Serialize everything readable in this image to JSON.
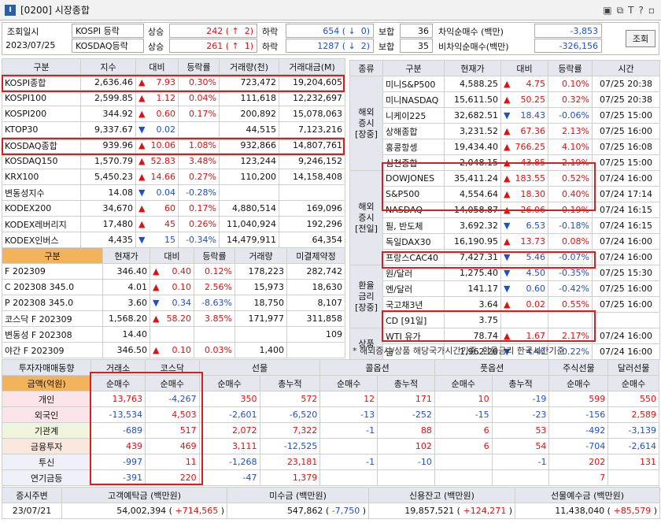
{
  "window": {
    "title": "[0200] 시장종합",
    "logo": "I",
    "icons": [
      "restore-icon",
      "popout-icon",
      "font-icon",
      "help-icon",
      "close-icon"
    ]
  },
  "summary": {
    "date_label": "조회일시",
    "date": "2023/07/25",
    "kospi_label": "KOSPI 등락",
    "kosdaq_label": "KOSDAQ등락",
    "up": "상승",
    "down": "하락",
    "flat": "보합",
    "kospi_up": "242",
    "kospi_up_limit": "2",
    "kospi_down": "654",
    "kospi_down_limit": "0",
    "kospi_flat": "36",
    "kosdaq_up": "261",
    "kosdaq_up_limit": "1",
    "kosdaq_down": "1287",
    "kosdaq_down_limit": "2",
    "kosdaq_flat": "35",
    "arb_label": "차익순매수 (백만)",
    "arb_value": "-3,853",
    "nonarb_label": "비차익순매수(백만)",
    "nonarb_value": "-326,156",
    "query_button": "조회"
  },
  "index": {
    "headers": [
      "구분",
      "지수",
      "대비",
      "등락률",
      "거래량(천)",
      "거래대금(M)"
    ],
    "rows": [
      [
        "KOSPI종합",
        "2,636.46",
        "▲",
        "7.93",
        "0.30%",
        "723,472",
        "19,204,605",
        "up"
      ],
      [
        "KOSPI100",
        "2,599.85",
        "▲",
        "1.12",
        "0.04%",
        "111,618",
        "12,232,697",
        "up"
      ],
      [
        "KOSPI200",
        "344.92",
        "▲",
        "0.60",
        "0.17%",
        "200,892",
        "15,078,063",
        "up"
      ],
      [
        "KTOP30",
        "9,337.67",
        "▼",
        "0.02",
        "",
        "44,515",
        "7,123,216",
        "dn"
      ],
      [
        "KOSDAQ종합",
        "939.96",
        "▲",
        "10.06",
        "1.08%",
        "932,866",
        "14,807,761",
        "up"
      ],
      [
        "KOSDAQ150",
        "1,570.79",
        "▲",
        "52.83",
        "3.48%",
        "123,244",
        "9,246,152",
        "up"
      ],
      [
        "KRX100",
        "5,450.23",
        "▲",
        "14.66",
        "0.27%",
        "110,200",
        "14,158,408",
        "up"
      ],
      [
        "변동성지수",
        "14.08",
        "▼",
        "0.04",
        "-0.28%",
        "",
        "",
        "dn"
      ],
      [
        "KODEX200",
        "34,670",
        "▲",
        "60",
        "0.17%",
        "4,880,514",
        "169,096",
        "up"
      ],
      [
        "KODEX레버리지",
        "17,480",
        "▲",
        "45",
        "0.26%",
        "11,040,924",
        "192,296",
        "up"
      ],
      [
        "KODEX인버스",
        "4,435",
        "▼",
        "15",
        "-0.34%",
        "14,479,911",
        "64,354",
        "dn"
      ]
    ]
  },
  "futures": {
    "headers": [
      "구분",
      "현재가",
      "대비",
      "등락률",
      "거래량",
      "미결제약정"
    ],
    "rows": [
      [
        "F 202309",
        "346.40",
        "▲",
        "0.40",
        "0.12%",
        "178,223",
        "282,742",
        "up"
      ],
      [
        "C 202308 345.0",
        "4.01",
        "▲",
        "0.10",
        "2.56%",
        "15,973",
        "18,630",
        "up"
      ],
      [
        "P 202308 345.0",
        "3.60",
        "▼",
        "0.34",
        "-8.63%",
        "18,750",
        "8,107",
        "dn"
      ],
      [
        "코스닥 F 202309",
        "1,568.20",
        "▲",
        "58.20",
        "3.85%",
        "171,977",
        "311,858",
        "up"
      ],
      [
        "변동성 F 202308",
        "14.40",
        "",
        "",
        "",
        "",
        "109",
        "up"
      ],
      [
        "야간 F 202309",
        "346.50",
        "▲",
        "0.10",
        "0.03%",
        "1,400",
        "",
        "up"
      ]
    ]
  },
  "world": {
    "headers": [
      "종류",
      "구분",
      "현재가",
      "대비",
      "등락률",
      "시간"
    ],
    "groups": [
      {
        "name": "해외\n증시\n[장중]",
        "rows": [
          [
            "미니S&P500",
            "4,588.25",
            "▲",
            "4.75",
            "0.10%",
            "07/25 20:38",
            "up"
          ],
          [
            "미니NASDAQ",
            "15,611.50",
            "▲",
            "50.25",
            "0.32%",
            "07/25 20:38",
            "up"
          ],
          [
            "니케이225",
            "32,682.51",
            "▼",
            "18.43",
            "-0.06%",
            "07/25 15:00",
            "dn"
          ],
          [
            "상해종합",
            "3,231.52",
            "▲",
            "67.36",
            "2.13%",
            "07/25 16:00",
            "up"
          ],
          [
            "홍콩항셍",
            "19,434.40",
            "▲",
            "766.25",
            "4.10%",
            "07/25 16:08",
            "up"
          ],
          [
            "심천종합",
            "2,048.15",
            "▲",
            "43.85",
            "2.19%",
            "07/25 15:00",
            "up"
          ]
        ]
      },
      {
        "name": "해외\n증시\n[전일]",
        "rows": [
          [
            "DOWJONES",
            "35,411.24",
            "▲",
            "183.55",
            "0.52%",
            "07/24 16:00",
            "up"
          ],
          [
            "S&P500",
            "4,554.64",
            "▲",
            "18.30",
            "0.40%",
            "07/24 17:14",
            "up"
          ],
          [
            "NASDAQ",
            "14,058.87",
            "▲",
            "26.06",
            "0.19%",
            "07/24 16:15",
            "up"
          ],
          [
            "필, 반도체",
            "3,692.32",
            "▼",
            "6.53",
            "-0.18%",
            "07/24 16:15",
            "dn"
          ],
          [
            "독일DAX30",
            "16,190.95",
            "▲",
            "13.73",
            "0.08%",
            "07/24 16:00",
            "up"
          ],
          [
            "프랑스CAC40",
            "7,427.31",
            "▼",
            "5.46",
            "-0.07%",
            "07/24 16:00",
            "dn"
          ]
        ]
      },
      {
        "name": "환율\n금리\n[장중]",
        "rows": [
          [
            "원/달러",
            "1,275.40",
            "▼",
            "4.50",
            "-0.35%",
            "07/25 15:30",
            "dn"
          ],
          [
            "엔/달러",
            "141.17",
            "▼",
            "0.60",
            "-0.42%",
            "07/25 16:00",
            "dn"
          ],
          [
            "국고채3년",
            "3.64",
            "▲",
            "0.02",
            "0.55%",
            "07/25 16:00",
            "up"
          ],
          [
            "CD [91일]",
            "3.75",
            "",
            "",
            "",
            "",
            ""
          ]
        ]
      },
      {
        "name": "상품",
        "rows": [
          [
            "WTI 유가",
            "78.74",
            "▲",
            "1.67",
            "2.17%",
            "07/24 16:00",
            "up"
          ],
          [
            "금",
            "1,962.20",
            "▼",
            "4.40",
            "-0.22%",
            "07/24 16:00",
            "dn"
          ]
        ]
      }
    ],
    "note": "* 해외증시/상품 해당국가시간기준, 환율금리 한국시간기준"
  },
  "investors": {
    "top_headers": [
      "투자자매매동향",
      "거래소",
      "코스닥",
      "선물",
      "콜옵션",
      "풋옵션",
      "주식선물",
      "달러선물"
    ],
    "unit_label": "금액(억원)",
    "sub": "순매수",
    "sub2": "총누적",
    "rows": [
      [
        "개인",
        "13,763",
        "-4,267",
        "350",
        "572",
        "12",
        "171",
        "10",
        "-19",
        "599",
        "550"
      ],
      [
        "외국인",
        "-13,534",
        "4,503",
        "-2,601",
        "-6,520",
        "-13",
        "-252",
        "-15",
        "-23",
        "-156",
        "2,589"
      ],
      [
        "기관계",
        "-689",
        "517",
        "2,072",
        "7,322",
        "-1",
        "88",
        "6",
        "53",
        "-492",
        "-3,139"
      ],
      [
        "금융투자",
        "439",
        "469",
        "3,111",
        "-12,525",
        "",
        "102",
        "6",
        "54",
        "-704",
        "-2,614"
      ],
      [
        "투신",
        "-997",
        "11",
        "-1,268",
        "23,181",
        "-1",
        "-10",
        "",
        "-1",
        "202",
        "131"
      ],
      [
        "연기금등",
        "-391",
        "220",
        "-47",
        "1,379",
        "",
        "",
        "",
        "",
        "7",
        ""
      ]
    ]
  },
  "deposits": {
    "headers": [
      "증시주변",
      "고객예탁금 (백만원)",
      "미수금 (백만원)",
      "신용잔고 (백만원)",
      "선물예수금 (백만원)"
    ],
    "date": "23/07/21",
    "customer": "54,002,394",
    "customer_chg": "+714,565",
    "unpaid": "547,862",
    "unpaid_chg": "-7,750",
    "credit": "19,857,521",
    "credit_chg": "+124,271",
    "futures_dep": "11,438,040",
    "futures_chg": "+85,579"
  }
}
